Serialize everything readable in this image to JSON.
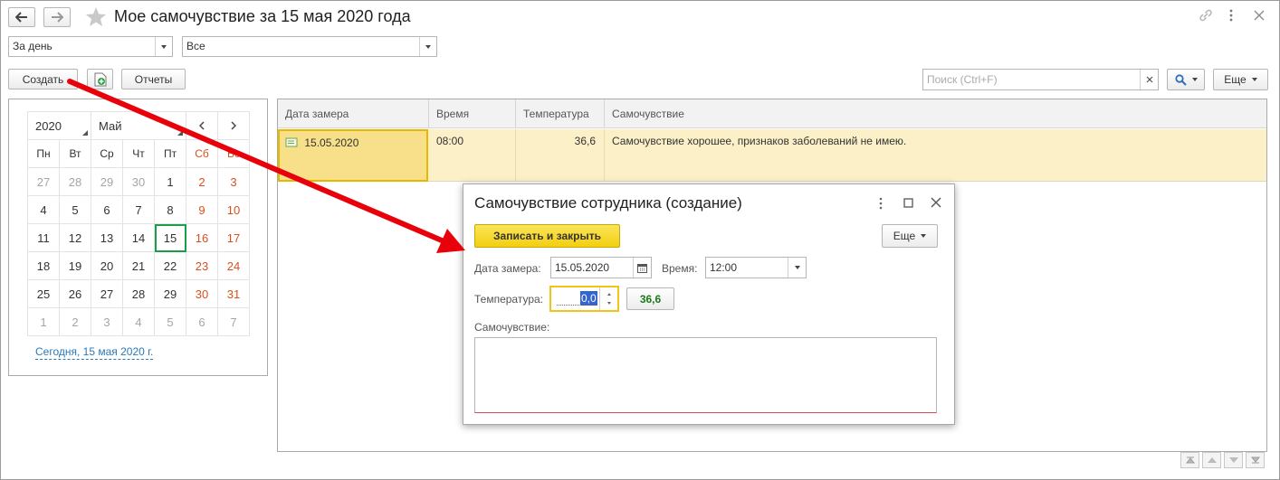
{
  "window": {
    "title": "Мое самочувствие за 15 мая 2020 года"
  },
  "filters": {
    "period": "За день",
    "scope": "Все"
  },
  "toolbar": {
    "create_label": "Создать",
    "reports_label": "Отчеты",
    "search_placeholder": "Поиск (Ctrl+F)",
    "more_label": "Еще"
  },
  "calendar": {
    "year": "2020",
    "month": "Май",
    "weekdays": [
      "Пн",
      "Вт",
      "Ср",
      "Чт",
      "Пт",
      "Сб",
      "Вс"
    ],
    "weeks": [
      [
        "27",
        "28",
        "29",
        "30",
        "1",
        "2",
        "3"
      ],
      [
        "4",
        "5",
        "6",
        "7",
        "8",
        "9",
        "10"
      ],
      [
        "11",
        "12",
        "13",
        "14",
        "15",
        "16",
        "17"
      ],
      [
        "18",
        "19",
        "20",
        "21",
        "22",
        "23",
        "24"
      ],
      [
        "25",
        "26",
        "27",
        "28",
        "29",
        "30",
        "31"
      ],
      [
        "1",
        "2",
        "3",
        "4",
        "5",
        "6",
        "7"
      ]
    ],
    "today_link": "Сегодня, 15 мая 2020 г."
  },
  "table": {
    "columns": [
      "Дата замера",
      "Время",
      "Температура",
      "Самочувствие"
    ],
    "rows": [
      {
        "date": "15.05.2020",
        "time": "08:00",
        "temperature": "36,6",
        "wellbeing": "Самочувствие хорошее, признаков заболеваний не имею."
      }
    ]
  },
  "dialog": {
    "title": "Самочувствие сотрудника (создание)",
    "save_close_label": "Записать и закрыть",
    "more_label": "Еще",
    "date_label": "Дата замера:",
    "date_value": "15.05.2020",
    "time_label": "Время:",
    "time_value": "12:00",
    "temperature_label": "Температура:",
    "temperature_value": "0,0",
    "temperature_preset": "36,6",
    "wellbeing_label": "Самочувствие:",
    "wellbeing_value": ""
  },
  "colors": {
    "selected_row": "#fbf0c7",
    "accent_yellow": "#f5d314",
    "weekend_red": "#d9501d",
    "today_green": "#1c9d4a",
    "arrow_red": "#e8000b",
    "link_blue": "#2a79b9",
    "preset_green": "#1a7a1a"
  }
}
